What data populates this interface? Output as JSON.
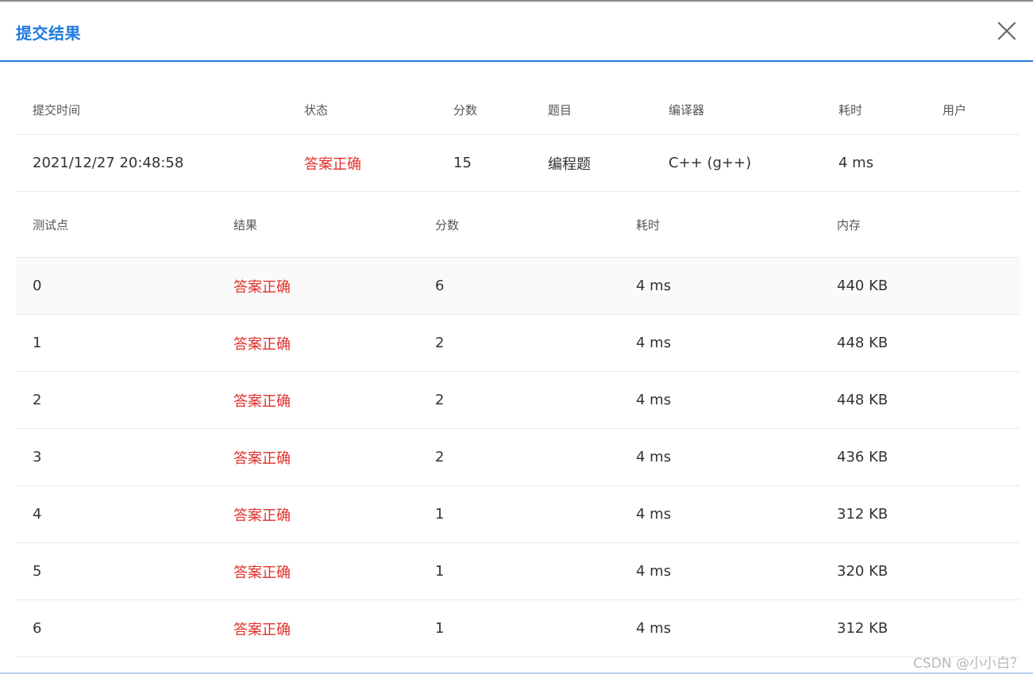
{
  "dialog": {
    "title": "提交结果",
    "close_icon": "close-icon"
  },
  "summary": {
    "headers": [
      "提交时间",
      "状态",
      "分数",
      "题目",
      "编译器",
      "耗时",
      "用户"
    ],
    "row": {
      "submit_time": "2021/12/27 20:48:58",
      "status": "答案正确",
      "score": "15",
      "problem": "编程题",
      "compiler": "C++ (g++)",
      "time": "4 ms",
      "user": ""
    }
  },
  "detail": {
    "headers": [
      "测试点",
      "结果",
      "分数",
      "耗时",
      "内存"
    ],
    "rows": [
      {
        "case": "0",
        "result": "答案正确",
        "score": "6",
        "time": "4 ms",
        "memory": "440 KB"
      },
      {
        "case": "1",
        "result": "答案正确",
        "score": "2",
        "time": "4 ms",
        "memory": "448 KB"
      },
      {
        "case": "2",
        "result": "答案正确",
        "score": "2",
        "time": "4 ms",
        "memory": "448 KB"
      },
      {
        "case": "3",
        "result": "答案正确",
        "score": "2",
        "time": "4 ms",
        "memory": "436 KB"
      },
      {
        "case": "4",
        "result": "答案正确",
        "score": "1",
        "time": "4 ms",
        "memory": "312 KB"
      },
      {
        "case": "5",
        "result": "答案正确",
        "score": "1",
        "time": "4 ms",
        "memory": "320 KB"
      },
      {
        "case": "6",
        "result": "答案正确",
        "score": "1",
        "time": "4 ms",
        "memory": "312 KB"
      }
    ]
  },
  "colors": {
    "accent": "#1f7ae0",
    "success_text": "#e0302b",
    "divider": "#e8e8e8"
  },
  "watermark": "CSDN @小小白？"
}
